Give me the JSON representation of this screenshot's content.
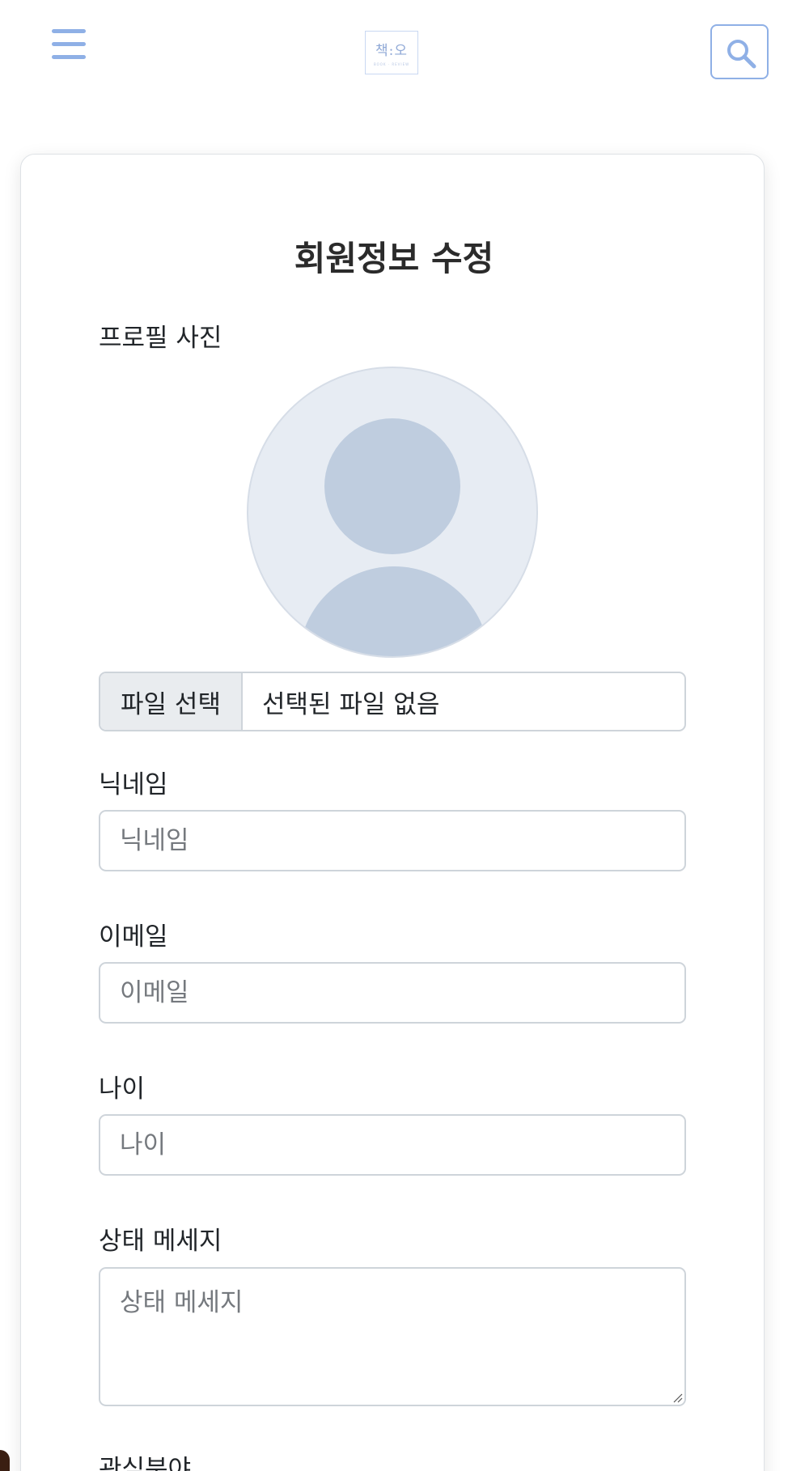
{
  "header": {
    "menu_icon": "hamburger-icon",
    "logo_text": "책:오",
    "logo_subtext": "BOOK · REVIEW",
    "search_icon": "search-icon",
    "accent_color": "#8fb0e6"
  },
  "form": {
    "title": "회원정보 수정",
    "profile_photo_label": "프로필 사진",
    "avatar_icon": "default-user-avatar",
    "file_button_label": "파일 선택",
    "file_status": "선택된 파일 없음",
    "nickname": {
      "label": "닉네임",
      "placeholder": "닉네임",
      "value": ""
    },
    "email": {
      "label": "이메일",
      "placeholder": "이메일",
      "value": ""
    },
    "age": {
      "label": "나이",
      "placeholder": "나이",
      "value": ""
    },
    "status_message": {
      "label": "상태 메세지",
      "placeholder": "상태 메세지",
      "value": ""
    },
    "interests_label": "관심분야"
  }
}
